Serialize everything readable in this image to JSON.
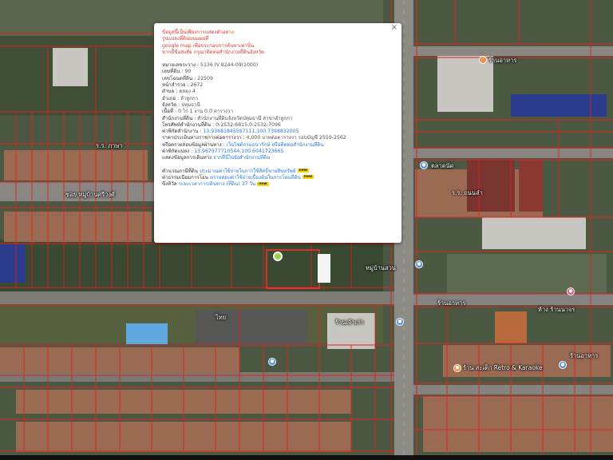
{
  "popup": {
    "header_lines": [
      "ข้อมูลนี้เป็นเพียงการแสดงตัวอย่าง",
      "รูปแปลงที่ดินบนแผนที่",
      "google map เพื่อประกอบการค้นหาเท่านั้น",
      "หากมีข้อสงสัย กรุณาติดต่อสำนักงานที่ดินจังหวัด"
    ],
    "rows": [
      {
        "label": "หมายเลขระวาง",
        "value": ": 5136 IV 8244-09(1000)"
      },
      {
        "label": "เลขที่ดิน",
        "value": ": 90"
      },
      {
        "label": "เลขโฉนดที่ดิน",
        "value": ": 22509"
      },
      {
        "label": "หน้าสำรวจ",
        "value": ": 2672"
      },
      {
        "label": "ตำบล",
        "value": ": คลอง 4"
      },
      {
        "label": "อำเภอ",
        "value": ": ลำลูกกา"
      },
      {
        "label": "จังหวัด",
        "value": ": ปทุมธานี"
      },
      {
        "label": "เนื้อที่",
        "value": ": 0 ไร่ 1 งาน 0.0 ตารางวา"
      },
      {
        "label": "สำนักงานที่ดิน",
        "value": ": สำนักงานที่ดินจังหวัดปทุมธานี สาขาลำลูกกา"
      },
      {
        "label": "โทรศัพท์สำนักงานที่ดิน",
        "value": ": 0-2532-6815,0-2532-7096"
      },
      {
        "label": "ค่าพิกัดสำนักงาน",
        "value": ": 13.93681845587111,100.7398832005",
        "blue": true
      },
      {
        "label": "ราคาประเมินทางราชการต่อตารางวา",
        "value": ": 4,000 บาทต่อตารางวา รอบบัญชี 2559-2562"
      },
      {
        "label": "หรือตรวจสอบข้อมูลผ่านทาง",
        "value": ": เว็บไซต์กรมธนารักษ์ หรือติดต่อสำนักงานที่ดิน",
        "blue": true
      },
      {
        "label": "ค่าพิกัดแปลง",
        "value": ": 13.967977710544,100.6041723665",
        "blue": true
      },
      {
        "label": "แสดงข้อมูลการเดินทาง",
        "value": "จากที่นี่ไปยังสำนักงานที่ดิน",
        "blue": true
      }
    ],
    "links": [
      {
        "label": "คำนวณภาษีที่ดิน",
        "value": "ประมาณค่าใช้จ่ายในการใช้สิทธิ์ขายสินทรัพย์",
        "badge": "new"
      },
      {
        "label": "ค่าธรรมเนียมการโอน",
        "value": "ตรวจสอบค่าใช้จ่ายเบื้องต้นในการโอนที่ดิน",
        "badge": "new"
      },
      {
        "label": "ขิงทิวัล",
        "value": "ระยะเวลาการเดินทาง (ที่ดิน) 37 วัน",
        "badge": "new"
      }
    ],
    "close_symbol": "×"
  },
  "map_labels": {
    "ตลาดนัด": "ตลาดนัด",
    "label_1": "ซอย หมู่บ้านศรีวงศ์",
    "label_2": "ร.ร. ภาษา",
    "label_3": "ร้านอาหาร",
    "label_4": "ร.ร. ถนนลำ",
    "label_5": "หมู่บ้านสวน",
    "label_6": "ร้านเจ้าเก่า",
    "label_7": "ร้านอาหาร",
    "label_8": "ร้าน สะเต็ก Retro & Karaoke",
    "label_9": "ห้าง ร้านนาจร",
    "label_10": "ไทย",
    "label_11": "ร้านอาหาร"
  },
  "poi_icons": [
    "restaurant-marker",
    "shop-marker",
    "pin-marker",
    "info-marker",
    "camera-marker",
    "food-marker",
    "point-marker"
  ]
}
